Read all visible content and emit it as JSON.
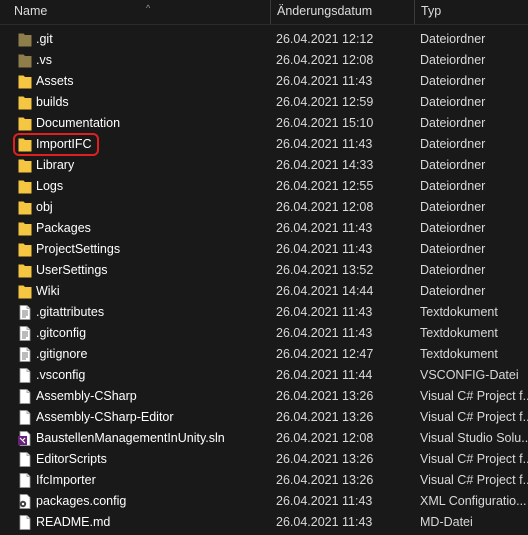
{
  "header": {
    "name": "Name",
    "date": "Änderungsdatum",
    "type": "Typ",
    "sort_indicator": "^"
  },
  "colors": {
    "folder": "#f5c542",
    "folder_hidden": "#8f7d4a",
    "highlight": "#e0201f"
  },
  "files": [
    {
      "name": ".git",
      "date": "26.04.2021 12:12",
      "type": "Dateiordner",
      "icon": "folder-hidden-icon"
    },
    {
      "name": ".vs",
      "date": "26.04.2021 12:08",
      "type": "Dateiordner",
      "icon": "folder-hidden-icon"
    },
    {
      "name": "Assets",
      "date": "26.04.2021 11:43",
      "type": "Dateiordner",
      "icon": "folder-icon"
    },
    {
      "name": "builds",
      "date": "26.04.2021 12:59",
      "type": "Dateiordner",
      "icon": "folder-icon"
    },
    {
      "name": "Documentation",
      "date": "26.04.2021 15:10",
      "type": "Dateiordner",
      "icon": "folder-icon"
    },
    {
      "name": "ImportIFC",
      "date": "26.04.2021 11:43",
      "type": "Dateiordner",
      "icon": "folder-icon"
    },
    {
      "name": "Library",
      "date": "26.04.2021 14:33",
      "type": "Dateiordner",
      "icon": "folder-icon"
    },
    {
      "name": "Logs",
      "date": "26.04.2021 12:55",
      "type": "Dateiordner",
      "icon": "folder-icon"
    },
    {
      "name": "obj",
      "date": "26.04.2021 12:08",
      "type": "Dateiordner",
      "icon": "folder-icon"
    },
    {
      "name": "Packages",
      "date": "26.04.2021 11:43",
      "type": "Dateiordner",
      "icon": "folder-icon"
    },
    {
      "name": "ProjectSettings",
      "date": "26.04.2021 11:43",
      "type": "Dateiordner",
      "icon": "folder-icon"
    },
    {
      "name": "UserSettings",
      "date": "26.04.2021 13:52",
      "type": "Dateiordner",
      "icon": "folder-icon"
    },
    {
      "name": "Wiki",
      "date": "26.04.2021 14:44",
      "type": "Dateiordner",
      "icon": "folder-icon"
    },
    {
      "name": ".gitattributes",
      "date": "26.04.2021 11:43",
      "type": "Textdokument",
      "icon": "text-document-icon"
    },
    {
      "name": ".gitconfig",
      "date": "26.04.2021 11:43",
      "type": "Textdokument",
      "icon": "text-document-icon"
    },
    {
      "name": ".gitignore",
      "date": "26.04.2021 12:47",
      "type": "Textdokument",
      "icon": "text-document-icon"
    },
    {
      "name": ".vsconfig",
      "date": "26.04.2021 11:44",
      "type": "VSCONFIG-Datei",
      "icon": "file-icon"
    },
    {
      "name": "Assembly-CSharp",
      "date": "26.04.2021 13:26",
      "type": "Visual C# Project f...",
      "icon": "file-icon"
    },
    {
      "name": "Assembly-CSharp-Editor",
      "date": "26.04.2021 13:26",
      "type": "Visual C# Project f...",
      "icon": "file-icon"
    },
    {
      "name": "BaustellenManagementInUnity.sln",
      "date": "26.04.2021 12:08",
      "type": "Visual Studio Solu...",
      "icon": "visual-studio-solution-icon"
    },
    {
      "name": "EditorScripts",
      "date": "26.04.2021 13:26",
      "type": "Visual C# Project f...",
      "icon": "file-icon"
    },
    {
      "name": "IfcImporter",
      "date": "26.04.2021 13:26",
      "type": "Visual C# Project f...",
      "icon": "file-icon"
    },
    {
      "name": "packages.config",
      "date": "26.04.2021 11:43",
      "type": "XML Configuratio...",
      "icon": "xml-config-icon"
    },
    {
      "name": "README.md",
      "date": "26.04.2021 11:43",
      "type": "MD-Datei",
      "icon": "file-icon"
    }
  ]
}
